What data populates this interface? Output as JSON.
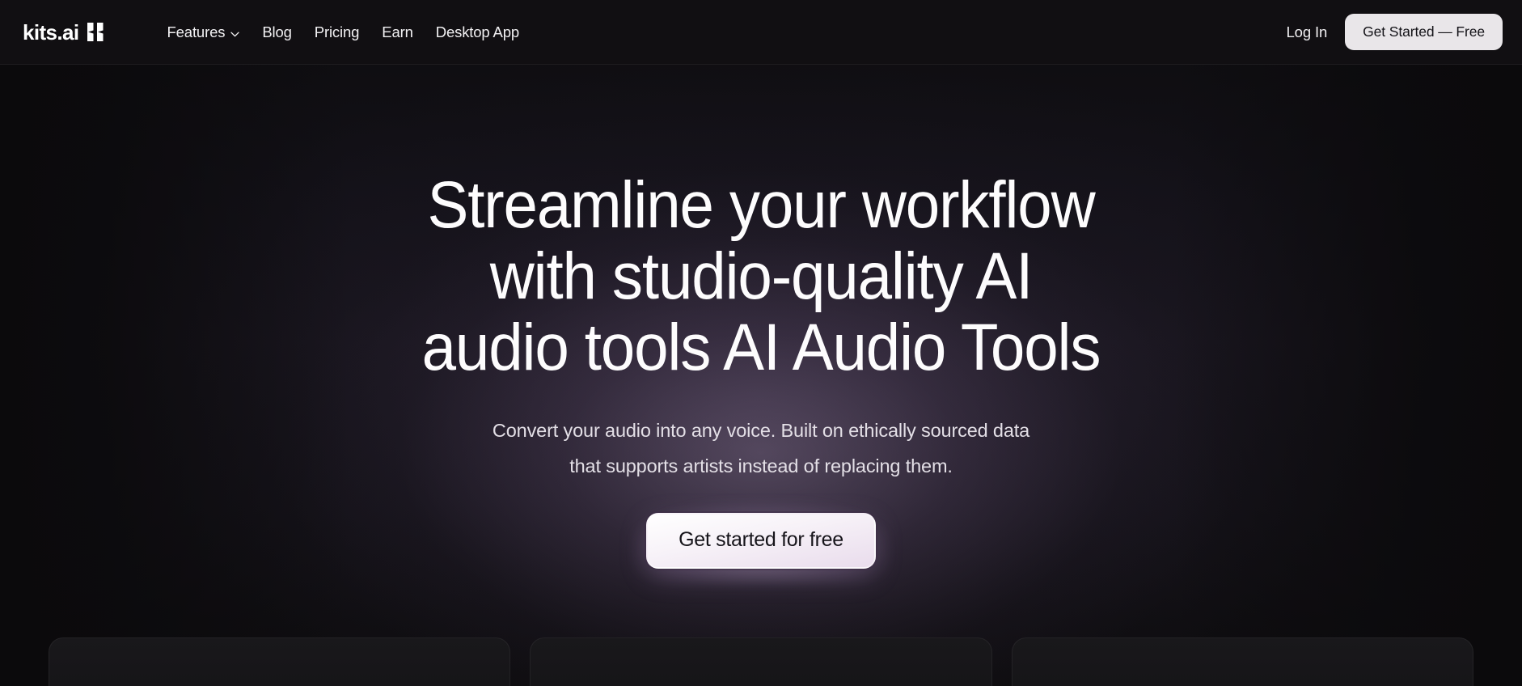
{
  "brand": {
    "name": "kits.ai",
    "logo_mark": "kits-k-logo-icon"
  },
  "nav": {
    "links": [
      {
        "label": "Features",
        "has_dropdown": true,
        "icon": "chevron-down-icon"
      },
      {
        "label": "Blog",
        "has_dropdown": false
      },
      {
        "label": "Pricing",
        "has_dropdown": false
      },
      {
        "label": "Earn",
        "has_dropdown": false
      },
      {
        "label": "Desktop App",
        "has_dropdown": false
      }
    ],
    "login_label": "Log In",
    "cta_label": "Get Started — Free"
  },
  "hero": {
    "headline_lines": [
      "Streamline your workflow",
      "with studio-quality AI",
      "audio tools AI Audio Tools"
    ],
    "subhead_lines": [
      "Convert your audio into any voice. Built on ethically sourced data",
      "that supports artists instead of replacing them."
    ],
    "cta_label": "Get started for free"
  },
  "colors": {
    "page_background": "#0b0a0c",
    "nav_background": "#110f12",
    "text_primary": "#fdfcfd",
    "text_secondary": "#e3dfe6",
    "cta_nav_background": "#e9e6e9",
    "cta_hero_background": "#f7f2f8",
    "glow_accent": "#c4a8d6",
    "card_background": "#19181b"
  },
  "cards": [
    {
      "id": "feature-card-1"
    },
    {
      "id": "feature-card-2"
    },
    {
      "id": "feature-card-3"
    }
  ]
}
